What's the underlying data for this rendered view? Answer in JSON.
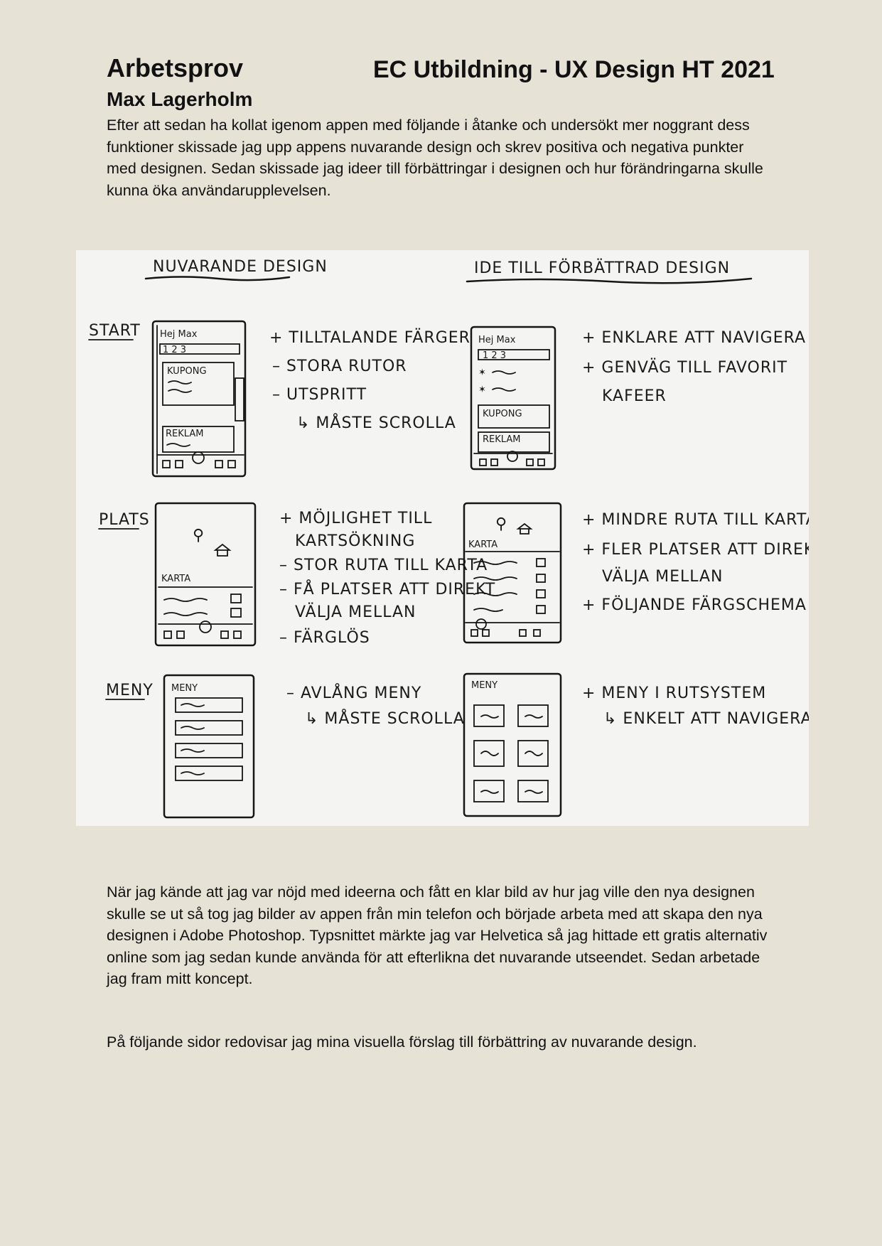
{
  "header": {
    "title": "Arbetsprov",
    "course": "EC Utbildning - UX Design HT 2021",
    "author": "Max Lagerholm"
  },
  "intro": "Efter att sedan ha kollat igenom appen med följande i åtanke och undersökt mer noggrant dess funktioner skissade jag upp appens nuvarande design och skrev positiva och negativa punkter med designen. Sedan skissade jag ideer till förbättringar i designen och hur förändringarna skulle kunna öka användarupplevelsen.",
  "sketch": {
    "col_current": "NUVARANDE DESIGN",
    "col_improved": "IDE TILL FÖRBÄTTRAD DESIGN",
    "rows": [
      {
        "label": "START",
        "current_notes": [
          "+ TILLTALANDE FÄRGER",
          "– STORA RUTOR",
          "– UTSPRITT",
          "↳ MÅSTE SCROLLA"
        ],
        "improved_notes": [
          "+ ENKLARE ATT NAVIGERA",
          "+ GENVÄG TILL FAVORIT",
          "KAFEER"
        ],
        "screen_greeting": "Hej Max",
        "screen_tabs": "1 2 3",
        "screen_kupong": "KUPONG",
        "screen_reklam": "REKLAM"
      },
      {
        "label": "PLATS",
        "current_notes": [
          "+ MÖJLIGHET TILL",
          "KARTSÖKNING",
          "– STOR RUTA TILL KARTA",
          "– FÅ PLATSER ATT DIREKT",
          "VÄLJA MELLAN",
          "– FÄRGLÖS"
        ],
        "improved_notes": [
          "+ MINDRE RUTA TILL KARTA",
          "+ FLER PLATSER ATT DIREKT",
          "VÄLJA MELLAN",
          "+ FÖLJANDE FÄRGSCHEMA"
        ],
        "screen_karta": "KARTA"
      },
      {
        "label": "MENY",
        "current_notes": [
          "– AVLÅNG MENY",
          "↳ MÅSTE SCROLLA"
        ],
        "improved_notes": [
          "+ MENY I RUTSYSTEM",
          "↳ ENKELT ATT NAVIGERA"
        ],
        "screen_meny": "MENY"
      }
    ]
  },
  "body_text": "När jag kände att jag var nöjd med ideerna och fått en klar bild av hur jag ville den nya designen skulle se ut så tog jag bilder av appen från min telefon och började arbeta med att skapa den nya designen i Adobe Photoshop. Typsnittet märkte jag var Helvetica så jag hittade ett gratis alternativ online som jag sedan kunde använda för att efterlikna det nuvarande utseendet. Sedan arbetade jag fram mitt koncept.",
  "closing_text": "På följande sidor redovisar jag mina visuella förslag till förbättring av nuvarande design."
}
